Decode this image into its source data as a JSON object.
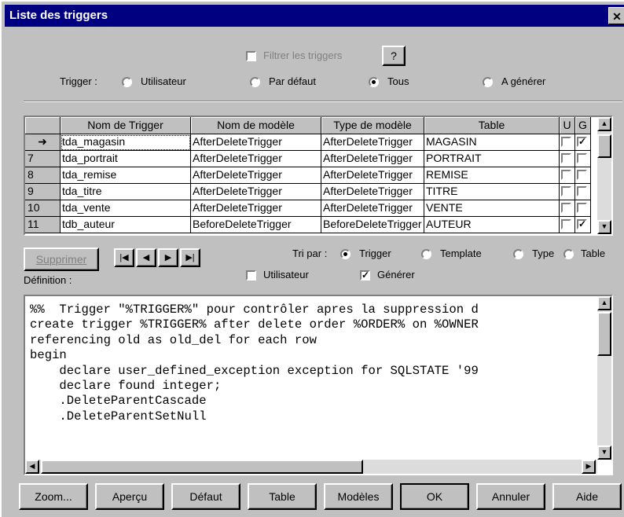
{
  "window": {
    "title": "Liste des triggers",
    "close_glyph": "✕"
  },
  "filter": {
    "label": "Filtrer les triggers",
    "checked": false,
    "help_label": "?"
  },
  "trigger_scope": {
    "label": "Trigger :",
    "options": [
      "Utilisateur",
      "Par défaut",
      "Tous",
      "A générer"
    ],
    "selected": "Tous"
  },
  "grid": {
    "columns": [
      "Nom de Trigger",
      "Nom de modèle",
      "Type de modèle",
      "Table",
      "U",
      "G"
    ],
    "rows": [
      {
        "num": "",
        "current": true,
        "name": "tda_magasin",
        "model": "AfterDeleteTrigger",
        "type": "AfterDeleteTrigger",
        "table": "MAGASIN",
        "u": false,
        "g": true
      },
      {
        "num": "7",
        "current": false,
        "name": "tda_portrait",
        "model": "AfterDeleteTrigger",
        "type": "AfterDeleteTrigger",
        "table": "PORTRAIT",
        "u": false,
        "g": false
      },
      {
        "num": "8",
        "current": false,
        "name": "tda_remise",
        "model": "AfterDeleteTrigger",
        "type": "AfterDeleteTrigger",
        "table": "REMISE",
        "u": false,
        "g": false
      },
      {
        "num": "9",
        "current": false,
        "name": "tda_titre",
        "model": "AfterDeleteTrigger",
        "type": "AfterDeleteTrigger",
        "table": "TITRE",
        "u": false,
        "g": false
      },
      {
        "num": "10",
        "current": false,
        "name": "tda_vente",
        "model": "AfterDeleteTrigger",
        "type": "AfterDeleteTrigger",
        "table": "VENTE",
        "u": false,
        "g": false
      },
      {
        "num": "11",
        "current": false,
        "name": "tdb_auteur",
        "model": "BeforeDeleteTrigger",
        "type": "BeforeDeleteTrigger",
        "table": "AUTEUR",
        "u": false,
        "g": true
      }
    ]
  },
  "toolbar": {
    "delete_label": "Supprimer",
    "nav_first": "|◀",
    "nav_prev": "◀",
    "nav_next": "▶",
    "nav_last": "▶|"
  },
  "sort": {
    "label": "Tri par :",
    "options": [
      "Trigger",
      "Template",
      "Type",
      "Table"
    ],
    "selected": "Trigger"
  },
  "definition": {
    "label": "Définition :",
    "user_label": "Utilisateur",
    "user_checked": false,
    "generate_label": "Générer",
    "generate_checked": true,
    "code_lines": [
      "%%  Trigger \"%TRIGGER%\" pour contrôler apres la suppression d",
      "create trigger %TRIGGER% after delete order %ORDER% on %OWNER",
      "referencing old as old_del for each row",
      "begin",
      "    declare user_defined_exception exception for SQLSTATE '99",
      "    declare found integer;",
      "    .DeleteParentCascade",
      "    .DeleteParentSetNull"
    ]
  },
  "buttons": {
    "zoom": "Zoom...",
    "preview": "Aperçu",
    "default": "Défaut",
    "table": "Table",
    "models": "Modèles",
    "ok": "OK",
    "cancel": "Annuler",
    "help": "Aide"
  }
}
